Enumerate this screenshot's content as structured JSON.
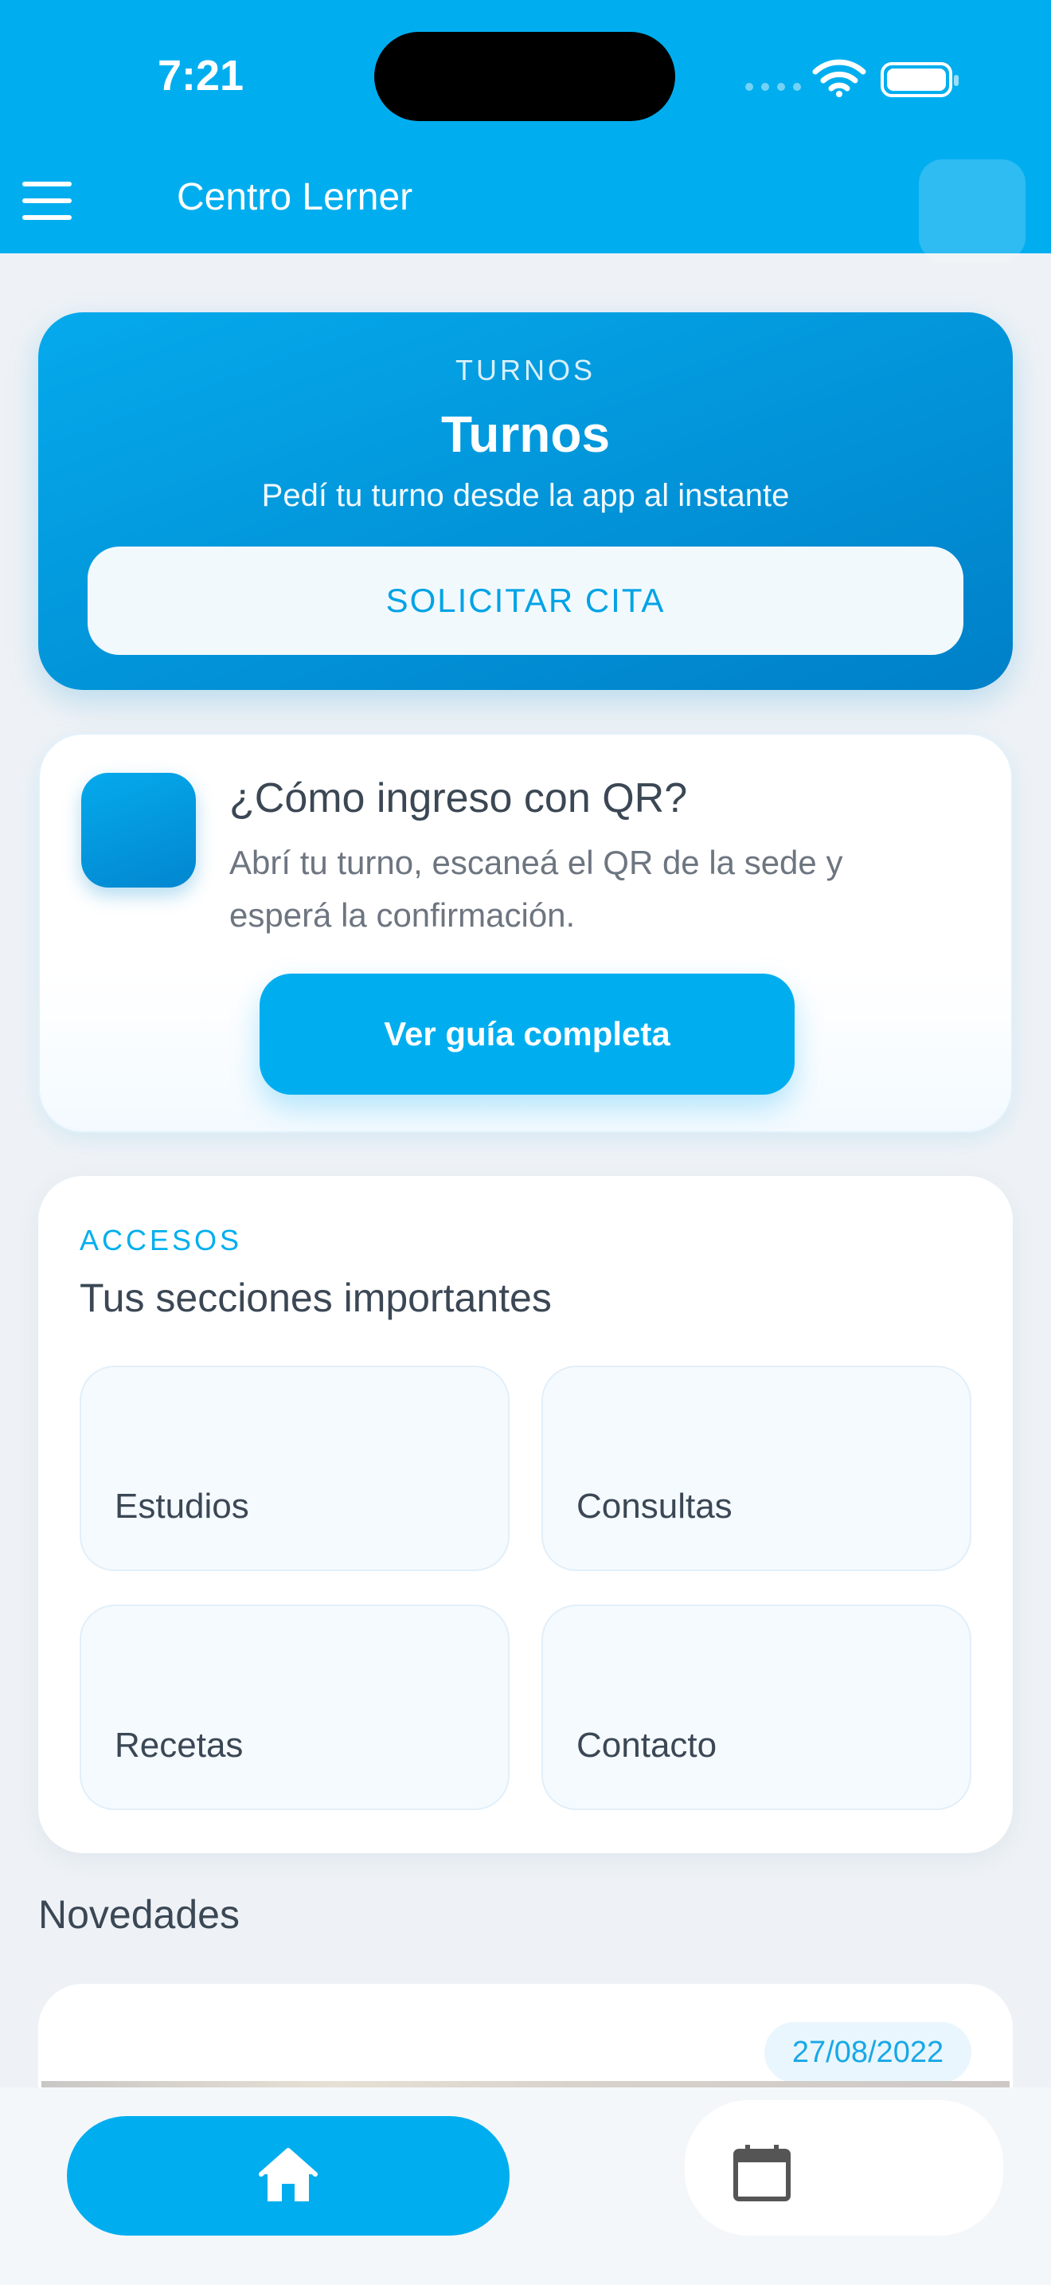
{
  "status_bar": {
    "time": "7:21"
  },
  "app_bar": {
    "title": "Centro Lerner"
  },
  "turnos_card": {
    "kicker": "TURNOS",
    "title": "Turnos",
    "subtitle": "Pedí tu turno desde la app al instante",
    "button_label": "SOLICITAR CITA"
  },
  "qr_card": {
    "title": "¿Cómo ingreso con QR?",
    "description": "Abrí tu turno, escaneá el QR de la sede y esperá la confirmación.",
    "button_label": "Ver guía completa"
  },
  "accesos": {
    "kicker": "ACCESOS",
    "title": "Tus secciones importantes",
    "tiles": [
      {
        "label": "Estudios"
      },
      {
        "label": "Consultas"
      },
      {
        "label": "Recetas"
      },
      {
        "label": "Contacto"
      }
    ]
  },
  "novedades": {
    "title": "Novedades",
    "items": [
      {
        "date": "27/08/2022"
      }
    ]
  },
  "bottom_nav": {
    "items": [
      {
        "icon": "home-icon",
        "active": true
      },
      {
        "icon": "calendar-icon",
        "active": false
      }
    ]
  },
  "colors": {
    "primary": "#00aeef",
    "primary_dark": "#0080c8",
    "text": "#3b4754",
    "muted_text": "#6d7580",
    "background": "#eef2f6"
  }
}
